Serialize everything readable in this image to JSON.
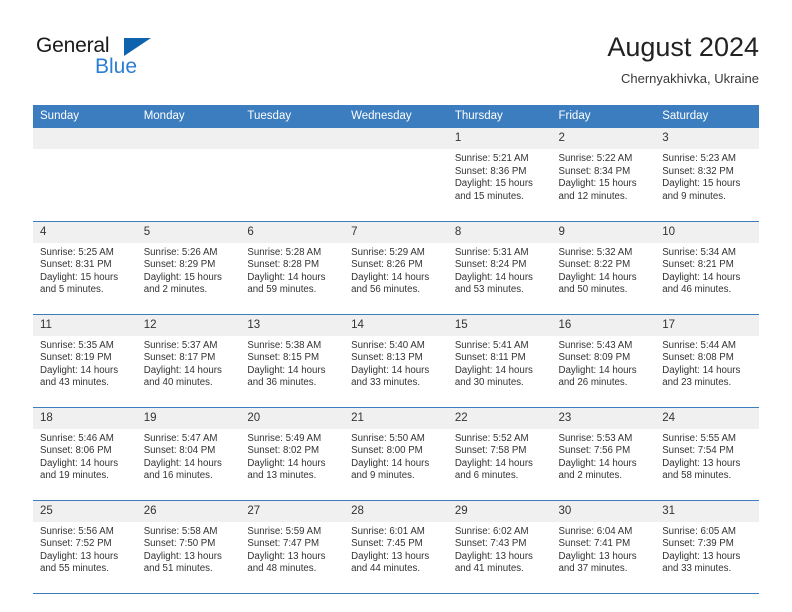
{
  "brand": {
    "name_top": "General",
    "name_bottom": "Blue",
    "triangle_color": "#0f63ad",
    "blue_color": "#2a7fd4"
  },
  "header": {
    "title": "August 2024",
    "subtitle": "Chernyakhivka, Ukraine"
  },
  "theme": {
    "header_bg": "#3b7dbf",
    "header_text": "#ffffff",
    "daynum_bg": "#f0f0f0",
    "grid_line": "#3b7dbf",
    "body_text": "#333333"
  },
  "columns": [
    "Sunday",
    "Monday",
    "Tuesday",
    "Wednesday",
    "Thursday",
    "Friday",
    "Saturday"
  ],
  "weeks": [
    [
      {
        "day": "",
        "empty": true
      },
      {
        "day": "",
        "empty": true
      },
      {
        "day": "",
        "empty": true
      },
      {
        "day": "",
        "empty": true
      },
      {
        "day": "1",
        "sunrise": "Sunrise: 5:21 AM",
        "sunset": "Sunset: 8:36 PM",
        "daylight1": "Daylight: 15 hours",
        "daylight2": "and 15 minutes."
      },
      {
        "day": "2",
        "sunrise": "Sunrise: 5:22 AM",
        "sunset": "Sunset: 8:34 PM",
        "daylight1": "Daylight: 15 hours",
        "daylight2": "and 12 minutes."
      },
      {
        "day": "3",
        "sunrise": "Sunrise: 5:23 AM",
        "sunset": "Sunset: 8:32 PM",
        "daylight1": "Daylight: 15 hours",
        "daylight2": "and 9 minutes."
      }
    ],
    [
      {
        "day": "4",
        "sunrise": "Sunrise: 5:25 AM",
        "sunset": "Sunset: 8:31 PM",
        "daylight1": "Daylight: 15 hours",
        "daylight2": "and 5 minutes."
      },
      {
        "day": "5",
        "sunrise": "Sunrise: 5:26 AM",
        "sunset": "Sunset: 8:29 PM",
        "daylight1": "Daylight: 15 hours",
        "daylight2": "and 2 minutes."
      },
      {
        "day": "6",
        "sunrise": "Sunrise: 5:28 AM",
        "sunset": "Sunset: 8:28 PM",
        "daylight1": "Daylight: 14 hours",
        "daylight2": "and 59 minutes."
      },
      {
        "day": "7",
        "sunrise": "Sunrise: 5:29 AM",
        "sunset": "Sunset: 8:26 PM",
        "daylight1": "Daylight: 14 hours",
        "daylight2": "and 56 minutes."
      },
      {
        "day": "8",
        "sunrise": "Sunrise: 5:31 AM",
        "sunset": "Sunset: 8:24 PM",
        "daylight1": "Daylight: 14 hours",
        "daylight2": "and 53 minutes."
      },
      {
        "day": "9",
        "sunrise": "Sunrise: 5:32 AM",
        "sunset": "Sunset: 8:22 PM",
        "daylight1": "Daylight: 14 hours",
        "daylight2": "and 50 minutes."
      },
      {
        "day": "10",
        "sunrise": "Sunrise: 5:34 AM",
        "sunset": "Sunset: 8:21 PM",
        "daylight1": "Daylight: 14 hours",
        "daylight2": "and 46 minutes."
      }
    ],
    [
      {
        "day": "11",
        "sunrise": "Sunrise: 5:35 AM",
        "sunset": "Sunset: 8:19 PM",
        "daylight1": "Daylight: 14 hours",
        "daylight2": "and 43 minutes."
      },
      {
        "day": "12",
        "sunrise": "Sunrise: 5:37 AM",
        "sunset": "Sunset: 8:17 PM",
        "daylight1": "Daylight: 14 hours",
        "daylight2": "and 40 minutes."
      },
      {
        "day": "13",
        "sunrise": "Sunrise: 5:38 AM",
        "sunset": "Sunset: 8:15 PM",
        "daylight1": "Daylight: 14 hours",
        "daylight2": "and 36 minutes."
      },
      {
        "day": "14",
        "sunrise": "Sunrise: 5:40 AM",
        "sunset": "Sunset: 8:13 PM",
        "daylight1": "Daylight: 14 hours",
        "daylight2": "and 33 minutes."
      },
      {
        "day": "15",
        "sunrise": "Sunrise: 5:41 AM",
        "sunset": "Sunset: 8:11 PM",
        "daylight1": "Daylight: 14 hours",
        "daylight2": "and 30 minutes."
      },
      {
        "day": "16",
        "sunrise": "Sunrise: 5:43 AM",
        "sunset": "Sunset: 8:09 PM",
        "daylight1": "Daylight: 14 hours",
        "daylight2": "and 26 minutes."
      },
      {
        "day": "17",
        "sunrise": "Sunrise: 5:44 AM",
        "sunset": "Sunset: 8:08 PM",
        "daylight1": "Daylight: 14 hours",
        "daylight2": "and 23 minutes."
      }
    ],
    [
      {
        "day": "18",
        "sunrise": "Sunrise: 5:46 AM",
        "sunset": "Sunset: 8:06 PM",
        "daylight1": "Daylight: 14 hours",
        "daylight2": "and 19 minutes."
      },
      {
        "day": "19",
        "sunrise": "Sunrise: 5:47 AM",
        "sunset": "Sunset: 8:04 PM",
        "daylight1": "Daylight: 14 hours",
        "daylight2": "and 16 minutes."
      },
      {
        "day": "20",
        "sunrise": "Sunrise: 5:49 AM",
        "sunset": "Sunset: 8:02 PM",
        "daylight1": "Daylight: 14 hours",
        "daylight2": "and 13 minutes."
      },
      {
        "day": "21",
        "sunrise": "Sunrise: 5:50 AM",
        "sunset": "Sunset: 8:00 PM",
        "daylight1": "Daylight: 14 hours",
        "daylight2": "and 9 minutes."
      },
      {
        "day": "22",
        "sunrise": "Sunrise: 5:52 AM",
        "sunset": "Sunset: 7:58 PM",
        "daylight1": "Daylight: 14 hours",
        "daylight2": "and 6 minutes."
      },
      {
        "day": "23",
        "sunrise": "Sunrise: 5:53 AM",
        "sunset": "Sunset: 7:56 PM",
        "daylight1": "Daylight: 14 hours",
        "daylight2": "and 2 minutes."
      },
      {
        "day": "24",
        "sunrise": "Sunrise: 5:55 AM",
        "sunset": "Sunset: 7:54 PM",
        "daylight1": "Daylight: 13 hours",
        "daylight2": "and 58 minutes."
      }
    ],
    [
      {
        "day": "25",
        "sunrise": "Sunrise: 5:56 AM",
        "sunset": "Sunset: 7:52 PM",
        "daylight1": "Daylight: 13 hours",
        "daylight2": "and 55 minutes."
      },
      {
        "day": "26",
        "sunrise": "Sunrise: 5:58 AM",
        "sunset": "Sunset: 7:50 PM",
        "daylight1": "Daylight: 13 hours",
        "daylight2": "and 51 minutes."
      },
      {
        "day": "27",
        "sunrise": "Sunrise: 5:59 AM",
        "sunset": "Sunset: 7:47 PM",
        "daylight1": "Daylight: 13 hours",
        "daylight2": "and 48 minutes."
      },
      {
        "day": "28",
        "sunrise": "Sunrise: 6:01 AM",
        "sunset": "Sunset: 7:45 PM",
        "daylight1": "Daylight: 13 hours",
        "daylight2": "and 44 minutes."
      },
      {
        "day": "29",
        "sunrise": "Sunrise: 6:02 AM",
        "sunset": "Sunset: 7:43 PM",
        "daylight1": "Daylight: 13 hours",
        "daylight2": "and 41 minutes."
      },
      {
        "day": "30",
        "sunrise": "Sunrise: 6:04 AM",
        "sunset": "Sunset: 7:41 PM",
        "daylight1": "Daylight: 13 hours",
        "daylight2": "and 37 minutes."
      },
      {
        "day": "31",
        "sunrise": "Sunrise: 6:05 AM",
        "sunset": "Sunset: 7:39 PM",
        "daylight1": "Daylight: 13 hours",
        "daylight2": "and 33 minutes."
      }
    ]
  ]
}
